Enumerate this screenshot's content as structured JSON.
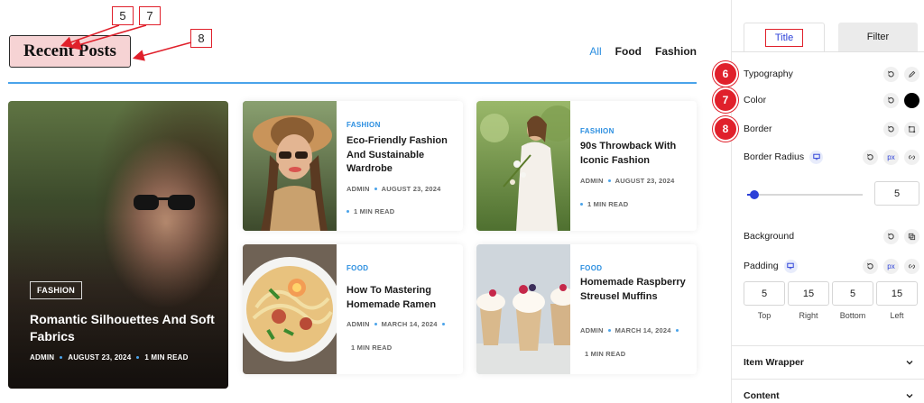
{
  "preview": {
    "heading": "Recent Posts",
    "callouts": [
      "5",
      "7",
      "8"
    ],
    "filters": [
      "All",
      "Food",
      "Fashion"
    ],
    "hero": {
      "category": "FASHION",
      "title": "Romantic Silhouettes And Soft Fabrics",
      "author": "ADMIN",
      "date": "AUGUST 23, 2024",
      "read": "1 MIN READ"
    },
    "cards": [
      {
        "category": "FASHION",
        "title": "Eco-Friendly Fashion And Sustainable Wardrobe",
        "author": "ADMIN",
        "date": "AUGUST 23, 2024",
        "read": "1 MIN READ"
      },
      {
        "category": "FASHION",
        "title": "90s Throwback With Iconic Fashion",
        "author": "ADMIN",
        "date": "AUGUST 23, 2024",
        "read": "1 MIN READ"
      },
      {
        "category": "FOOD",
        "title": "How To Mastering Homemade Ramen",
        "author": "ADMIN",
        "date": "MARCH 14, 2024",
        "read": "1 MIN READ"
      },
      {
        "category": "FOOD",
        "title": "Homemade Raspberry Streusel Muffins",
        "author": "ADMIN",
        "date": "MARCH 14, 2024",
        "read": "1 MIN READ"
      }
    ]
  },
  "panel": {
    "tabs": [
      "Title",
      "Filter"
    ],
    "typography": "Typography",
    "color": "Color",
    "border": "Border",
    "border_radius": "Border Radius",
    "unit": "px",
    "radius_value": "5",
    "radius_slider_fraction": 0.05,
    "background": "Background",
    "padding": "Padding",
    "padding_values": [
      "5",
      "15",
      "5",
      "15"
    ],
    "padding_labels": [
      "Top",
      "Right",
      "Bottom",
      "Left"
    ],
    "step_badges": [
      "6",
      "7",
      "8"
    ],
    "sections": [
      "Item Wrapper",
      "Content"
    ],
    "color_value": "#000000"
  },
  "colors": {
    "accent": "#2c8fe0",
    "control_blue": "#2c40d8",
    "highlight_red": "#e0202b"
  }
}
